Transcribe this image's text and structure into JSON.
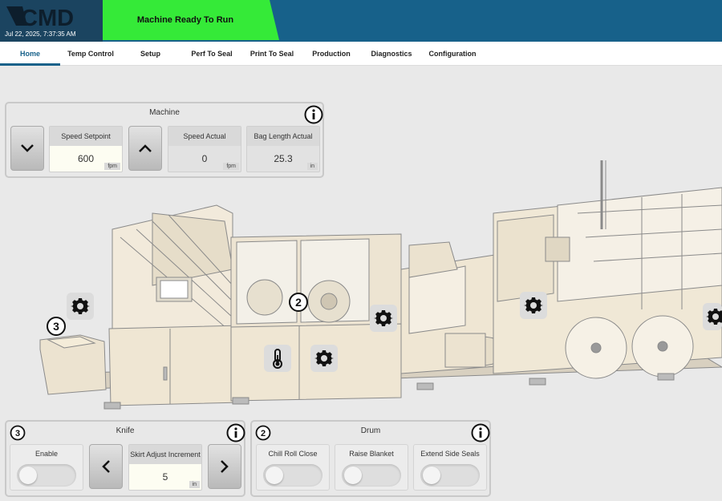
{
  "header": {
    "logo_text": "CMD",
    "datetime": "Jul 22, 2025, 7:37:35 AM",
    "status": "Machine Ready To Run",
    "status_color": "#35ea38",
    "bar_color": "#17618a"
  },
  "tabs": [
    {
      "label": "Home",
      "active": true
    },
    {
      "label": "Temp Control"
    },
    {
      "label": "Setup"
    },
    {
      "label": "Perf To Seal"
    },
    {
      "label": "Print To Seal"
    },
    {
      "label": "Production"
    },
    {
      "label": "Diagnostics"
    },
    {
      "label": "Configuration"
    }
  ],
  "machine_panel": {
    "title": "Machine",
    "speed_setpoint": {
      "label": "Speed Setpoint",
      "value": "600",
      "unit": "fpm"
    },
    "speed_actual": {
      "label": "Speed Actual",
      "value": "0",
      "unit": "fpm"
    },
    "bag_length_actual": {
      "label": "Bag Length Actual",
      "value": "25.3",
      "unit": "in"
    },
    "decrease_icon": "chevron-down-icon",
    "increase_icon": "chevron-up-icon",
    "info_icon": "info-icon"
  },
  "diagram": {
    "markers": [
      "3",
      "2"
    ],
    "icons": [
      "gear-icon",
      "gear-icon",
      "thermometer-icon",
      "gear-icon",
      "gear-icon",
      "gear-icon",
      "gear-icon"
    ]
  },
  "knife_panel": {
    "number": "3",
    "title": "Knife",
    "enable_label": "Enable",
    "skirt_adjust": {
      "label": "Skirt Adjust Increment",
      "value": "5",
      "unit": "in"
    },
    "prev_icon": "chevron-left-icon",
    "next_icon": "chevron-right-icon"
  },
  "drum_panel": {
    "number": "2",
    "title": "Drum",
    "toggles": [
      "Chill Roll Close",
      "Raise Blanket",
      "Extend Side Seals"
    ]
  }
}
